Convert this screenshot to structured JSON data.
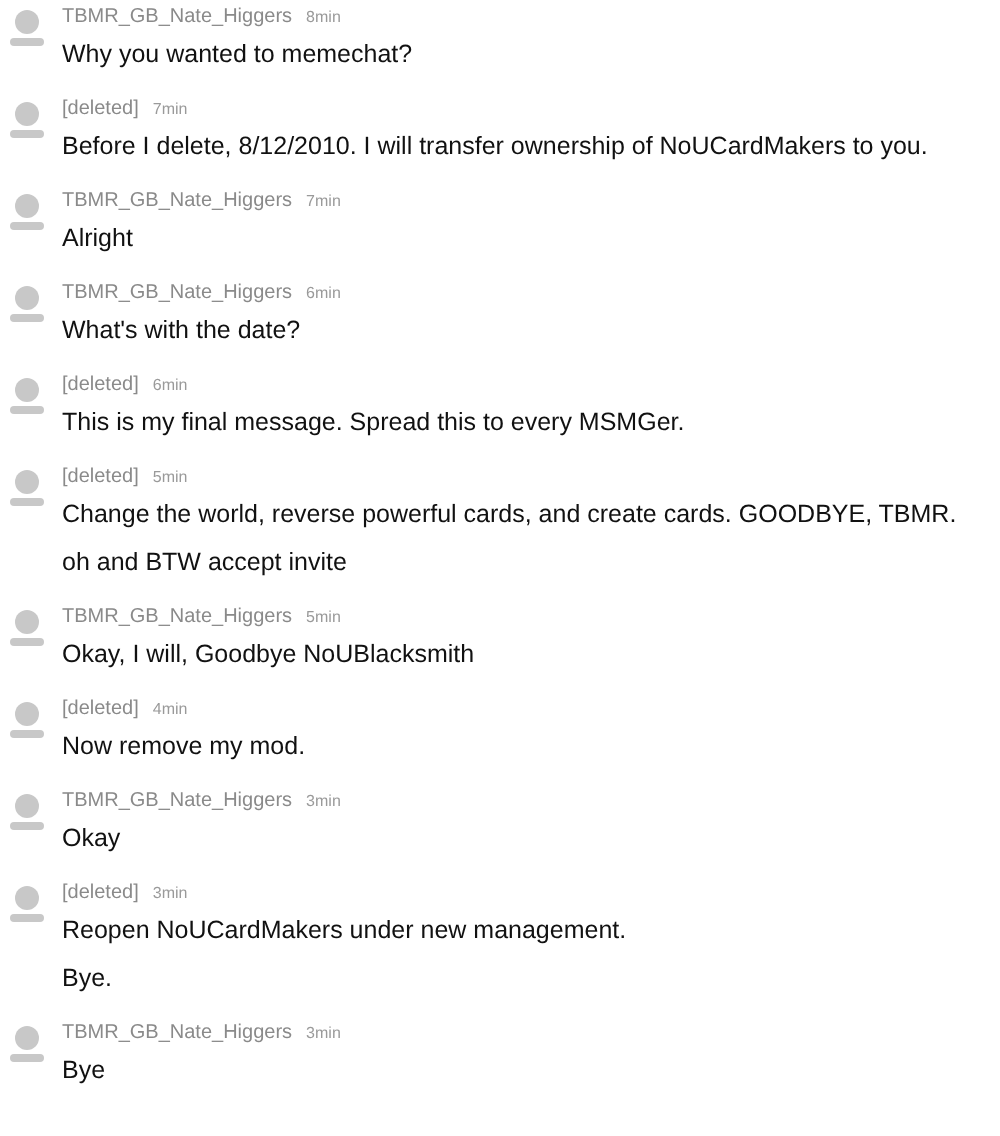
{
  "messages": [
    {
      "author": "TBMR_GB_Nate_Higgers",
      "time": "8min",
      "lines": [
        "Why you wanted to memechat?"
      ]
    },
    {
      "author": "[deleted]",
      "time": "7min",
      "lines": [
        "Before I delete, 8/12/2010. I will transfer ownership of NoUCardMakers to you."
      ]
    },
    {
      "author": "TBMR_GB_Nate_Higgers",
      "time": "7min",
      "lines": [
        "Alright"
      ]
    },
    {
      "author": "TBMR_GB_Nate_Higgers",
      "time": "6min",
      "lines": [
        "What's with the date?"
      ]
    },
    {
      "author": "[deleted]",
      "time": "6min",
      "lines": [
        "This is my final message. Spread this to every MSMGer."
      ]
    },
    {
      "author": "[deleted]",
      "time": "5min",
      "lines": [
        "Change the world, reverse powerful cards, and create cards. GOODBYE, TBMR.",
        "oh and BTW accept invite"
      ]
    },
    {
      "author": "TBMR_GB_Nate_Higgers",
      "time": "5min",
      "lines": [
        "Okay, I will, Goodbye NoUBlacksmith"
      ]
    },
    {
      "author": "[deleted]",
      "time": "4min",
      "lines": [
        "Now remove my mod."
      ]
    },
    {
      "author": "TBMR_GB_Nate_Higgers",
      "time": "3min",
      "lines": [
        "Okay"
      ]
    },
    {
      "author": "[deleted]",
      "time": "3min",
      "lines": [
        "Reopen NoUCardMakers under new management.",
        "Bye."
      ]
    },
    {
      "author": "TBMR_GB_Nate_Higgers",
      "time": "3min",
      "lines": [
        "Bye"
      ]
    }
  ]
}
